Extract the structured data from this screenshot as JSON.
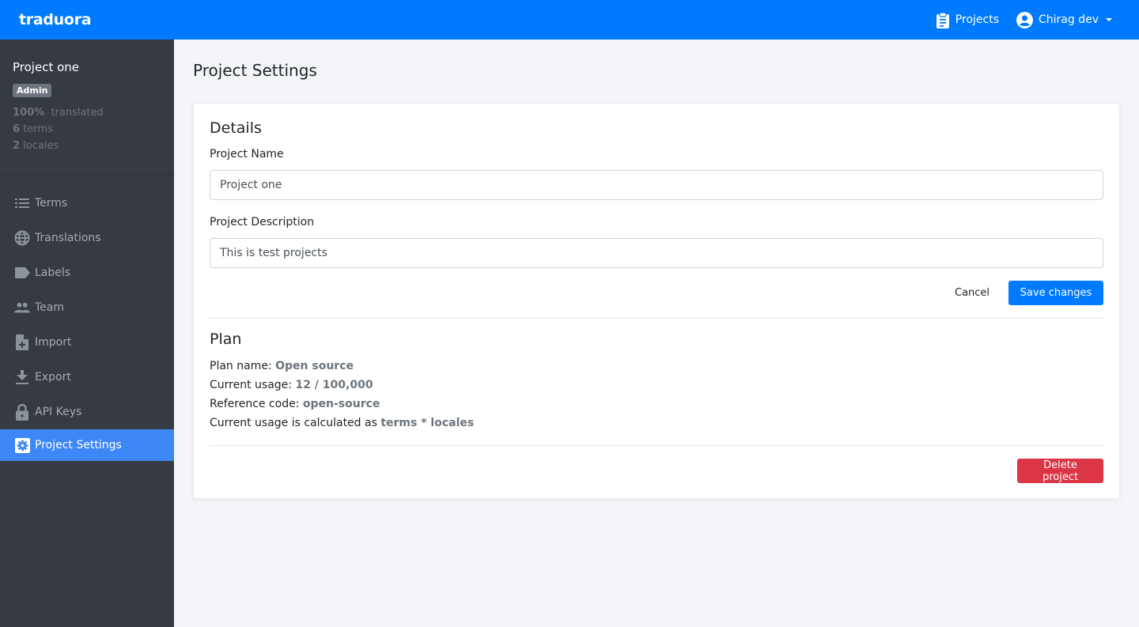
{
  "navbar": {
    "brand": "traduora",
    "projects_label": "Projects",
    "user_label": "Chirag dev",
    "colors": {
      "background": "#007bff"
    }
  },
  "sidebar": {
    "project_name": "Project one",
    "role_badge": "Admin",
    "stats": {
      "translated_value": "100%",
      "translated_label": "translated",
      "terms_value": "6",
      "terms_label": "terms",
      "locales_value": "2",
      "locales_label": "locales"
    },
    "items": [
      {
        "label": "Terms",
        "icon": "list-icon",
        "active": false
      },
      {
        "label": "Translations",
        "icon": "globe-icon",
        "active": false
      },
      {
        "label": "Labels",
        "icon": "label-icon",
        "active": false
      },
      {
        "label": "Team",
        "icon": "team-icon",
        "active": false
      },
      {
        "label": "Import",
        "icon": "file-import-icon",
        "active": false
      },
      {
        "label": "Export",
        "icon": "download-icon",
        "active": false
      },
      {
        "label": "API Keys",
        "icon": "lock-icon",
        "active": false
      },
      {
        "label": "Project Settings",
        "icon": "gear-icon",
        "active": true
      }
    ],
    "colors": {
      "background": "#353a43",
      "active": "#3e87f6"
    }
  },
  "main": {
    "page_title": "Project Settings",
    "details": {
      "title": "Details",
      "name_label": "Project Name",
      "name_value": "Project one",
      "description_label": "Project Description",
      "description_value": "This is test projects",
      "cancel_label": "Cancel",
      "save_label": "Save changes"
    },
    "plan": {
      "title": "Plan",
      "plan_name_label": "Plan name:",
      "plan_name_value": "Open source",
      "usage_label": "Current usage:",
      "usage_value": "12 / 100,000",
      "reference_label": "Reference code:",
      "reference_value": "open-source",
      "calc_label": "Current usage is calculated as",
      "calc_value": "terms * locales"
    },
    "delete_label": "Delete project",
    "colors": {
      "primary": "#007bff",
      "danger": "#dc3545"
    }
  }
}
